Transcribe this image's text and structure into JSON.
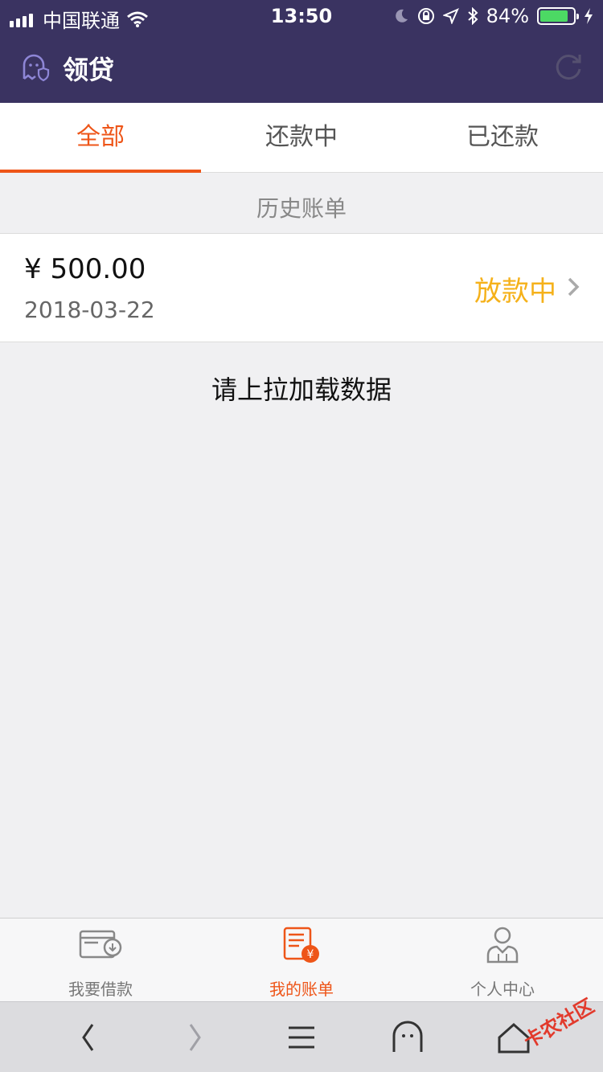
{
  "status_bar": {
    "carrier": "中国联通",
    "time": "13:50",
    "battery": "84%",
    "battery_level": 0.84
  },
  "header": {
    "title": "领贷",
    "logo_icon": "ghost-shield-icon",
    "refresh_icon": "refresh-icon"
  },
  "tabs": [
    {
      "label": "全部",
      "active": true
    },
    {
      "label": "还款中",
      "active": false
    },
    {
      "label": "已还款",
      "active": false
    }
  ],
  "section_title": "历史账单",
  "bills": [
    {
      "amount": "¥ 500.00",
      "date": "2018-03-22",
      "status": "放款中"
    }
  ],
  "load_more": "请上拉加载数据",
  "bottom_nav": [
    {
      "label": "我要借款",
      "icon": "wallet-icon",
      "active": false
    },
    {
      "label": "我的账单",
      "icon": "bill-icon",
      "active": true
    },
    {
      "label": "个人中心",
      "icon": "user-icon",
      "active": false
    }
  ],
  "browser_toolbar": [
    "back-icon",
    "forward-icon",
    "menu-icon",
    "ghost-icon",
    "home-icon"
  ],
  "watermark": "卡农社区",
  "colors": {
    "header_bg": "#3a3361",
    "accent": "#ee5518",
    "status_pending": "#f5b11a"
  }
}
